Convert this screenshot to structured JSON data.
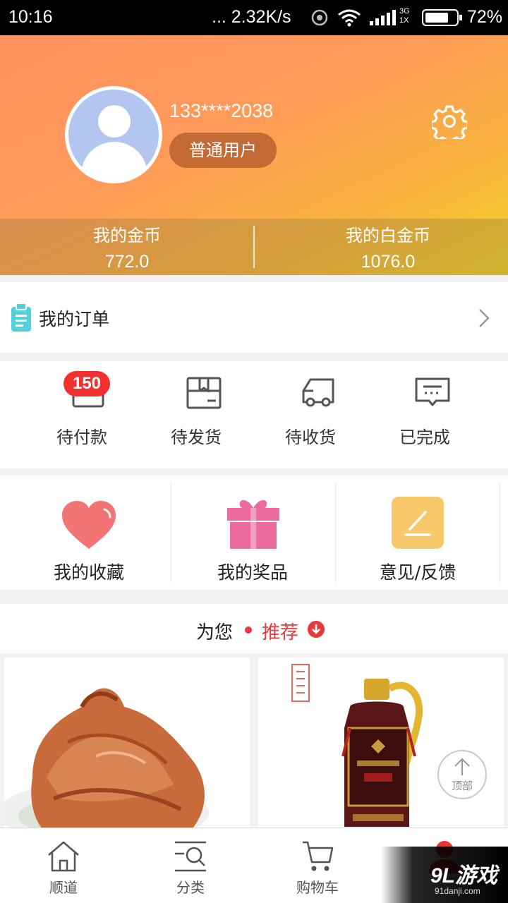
{
  "status_bar": {
    "time": "10:16",
    "network": "... 2.32K/s",
    "signal_label": "3G 1X",
    "battery": "72%"
  },
  "profile": {
    "phone": "133****2038",
    "user_type": "普通用户",
    "gold_label": "我的金币",
    "gold_value": "772.0",
    "platinum_label": "我的白金币",
    "platinum_value": "1076.0"
  },
  "orders": {
    "title": "我的订单"
  },
  "order_status": [
    {
      "label": "待付款",
      "badge": "150",
      "icon": "wallet-icon"
    },
    {
      "label": "待发货",
      "icon": "package-icon"
    },
    {
      "label": "待收货",
      "icon": "truck-icon"
    },
    {
      "label": "已完成",
      "icon": "message-icon"
    }
  ],
  "features": [
    {
      "label": "我的收藏",
      "icon": "heart-icon",
      "color": "#f27474"
    },
    {
      "label": "我的奖品",
      "icon": "gift-icon",
      "color": "#ec6a9c"
    },
    {
      "label": "意见/反馈",
      "icon": "feedback-icon",
      "color": "#f7c96a"
    }
  ],
  "recommend": {
    "prefix": "为您",
    "highlight": "推荐",
    "accent": "#e83a3a"
  },
  "back_to_top": "顶部",
  "bottom_nav": [
    {
      "label": "顺道",
      "icon": "home-icon"
    },
    {
      "label": "分类",
      "icon": "search-list-icon"
    },
    {
      "label": "购物车",
      "icon": "cart-icon"
    },
    {
      "label": "",
      "icon": "profile-icon"
    }
  ],
  "watermark": {
    "brand": "9L游戏",
    "domain": "91danji.com"
  }
}
